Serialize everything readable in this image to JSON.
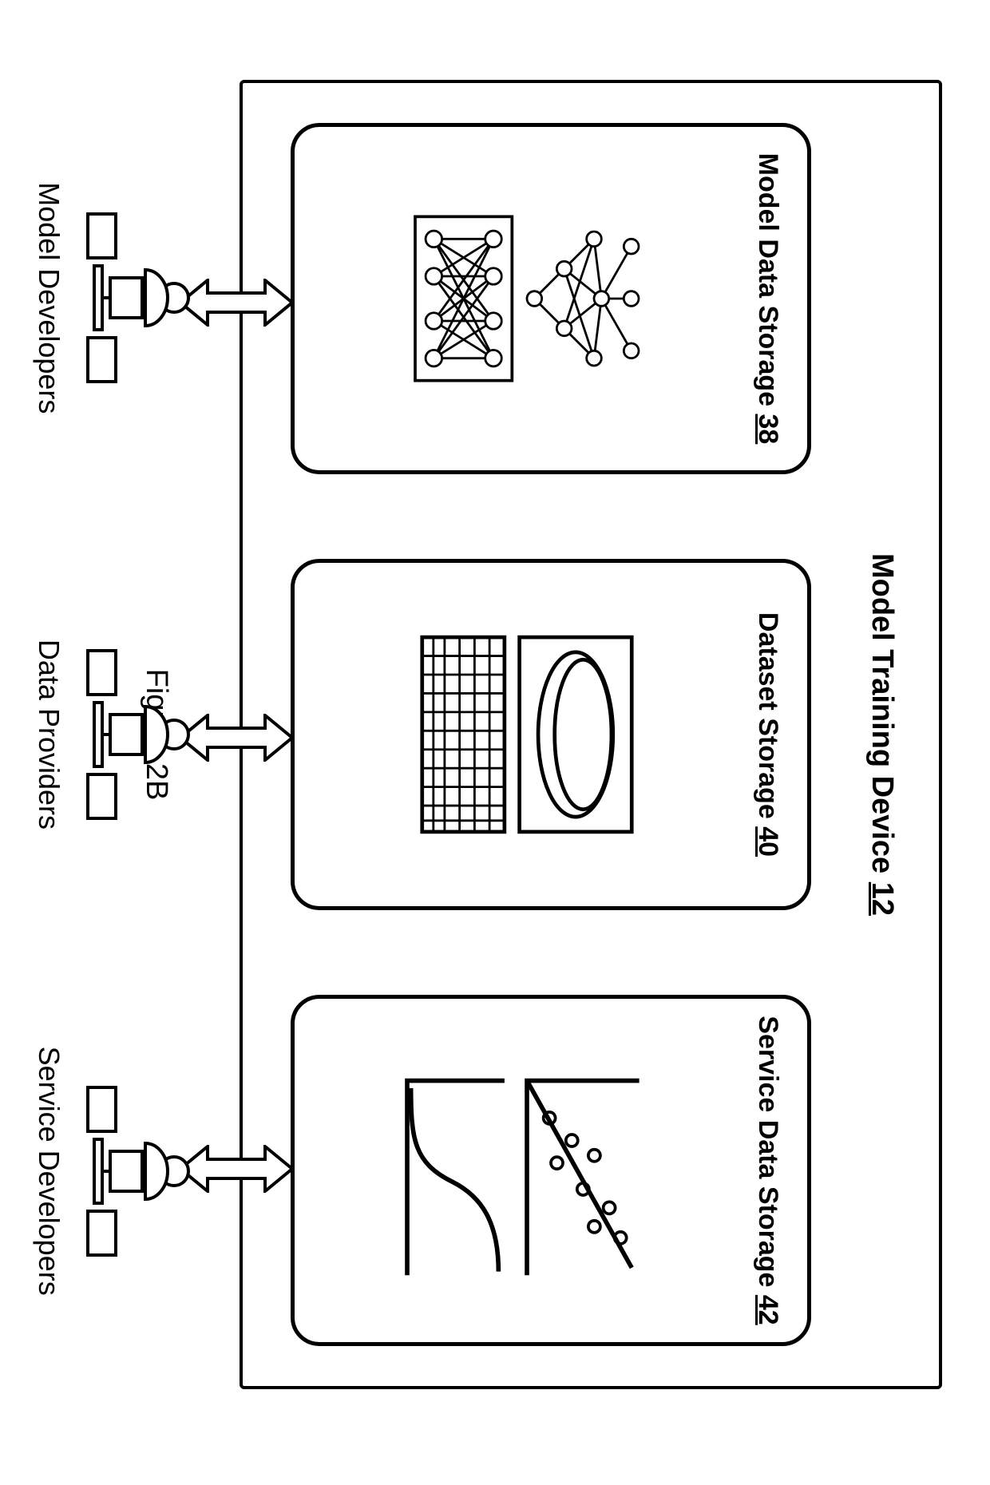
{
  "device": {
    "title_prefix": "Model Training Device",
    "title_num": "12"
  },
  "cards": {
    "model": {
      "title_prefix": "Model Data Storage",
      "num": "38"
    },
    "dataset": {
      "title_prefix": "Dataset Storage",
      "num": "40"
    },
    "service": {
      "title_prefix": "Service Data Storage",
      "num": "42"
    }
  },
  "actors": {
    "model": "Model Developers",
    "data": "Data Providers",
    "service": "Service Developers"
  },
  "caption": "Figure 2B"
}
